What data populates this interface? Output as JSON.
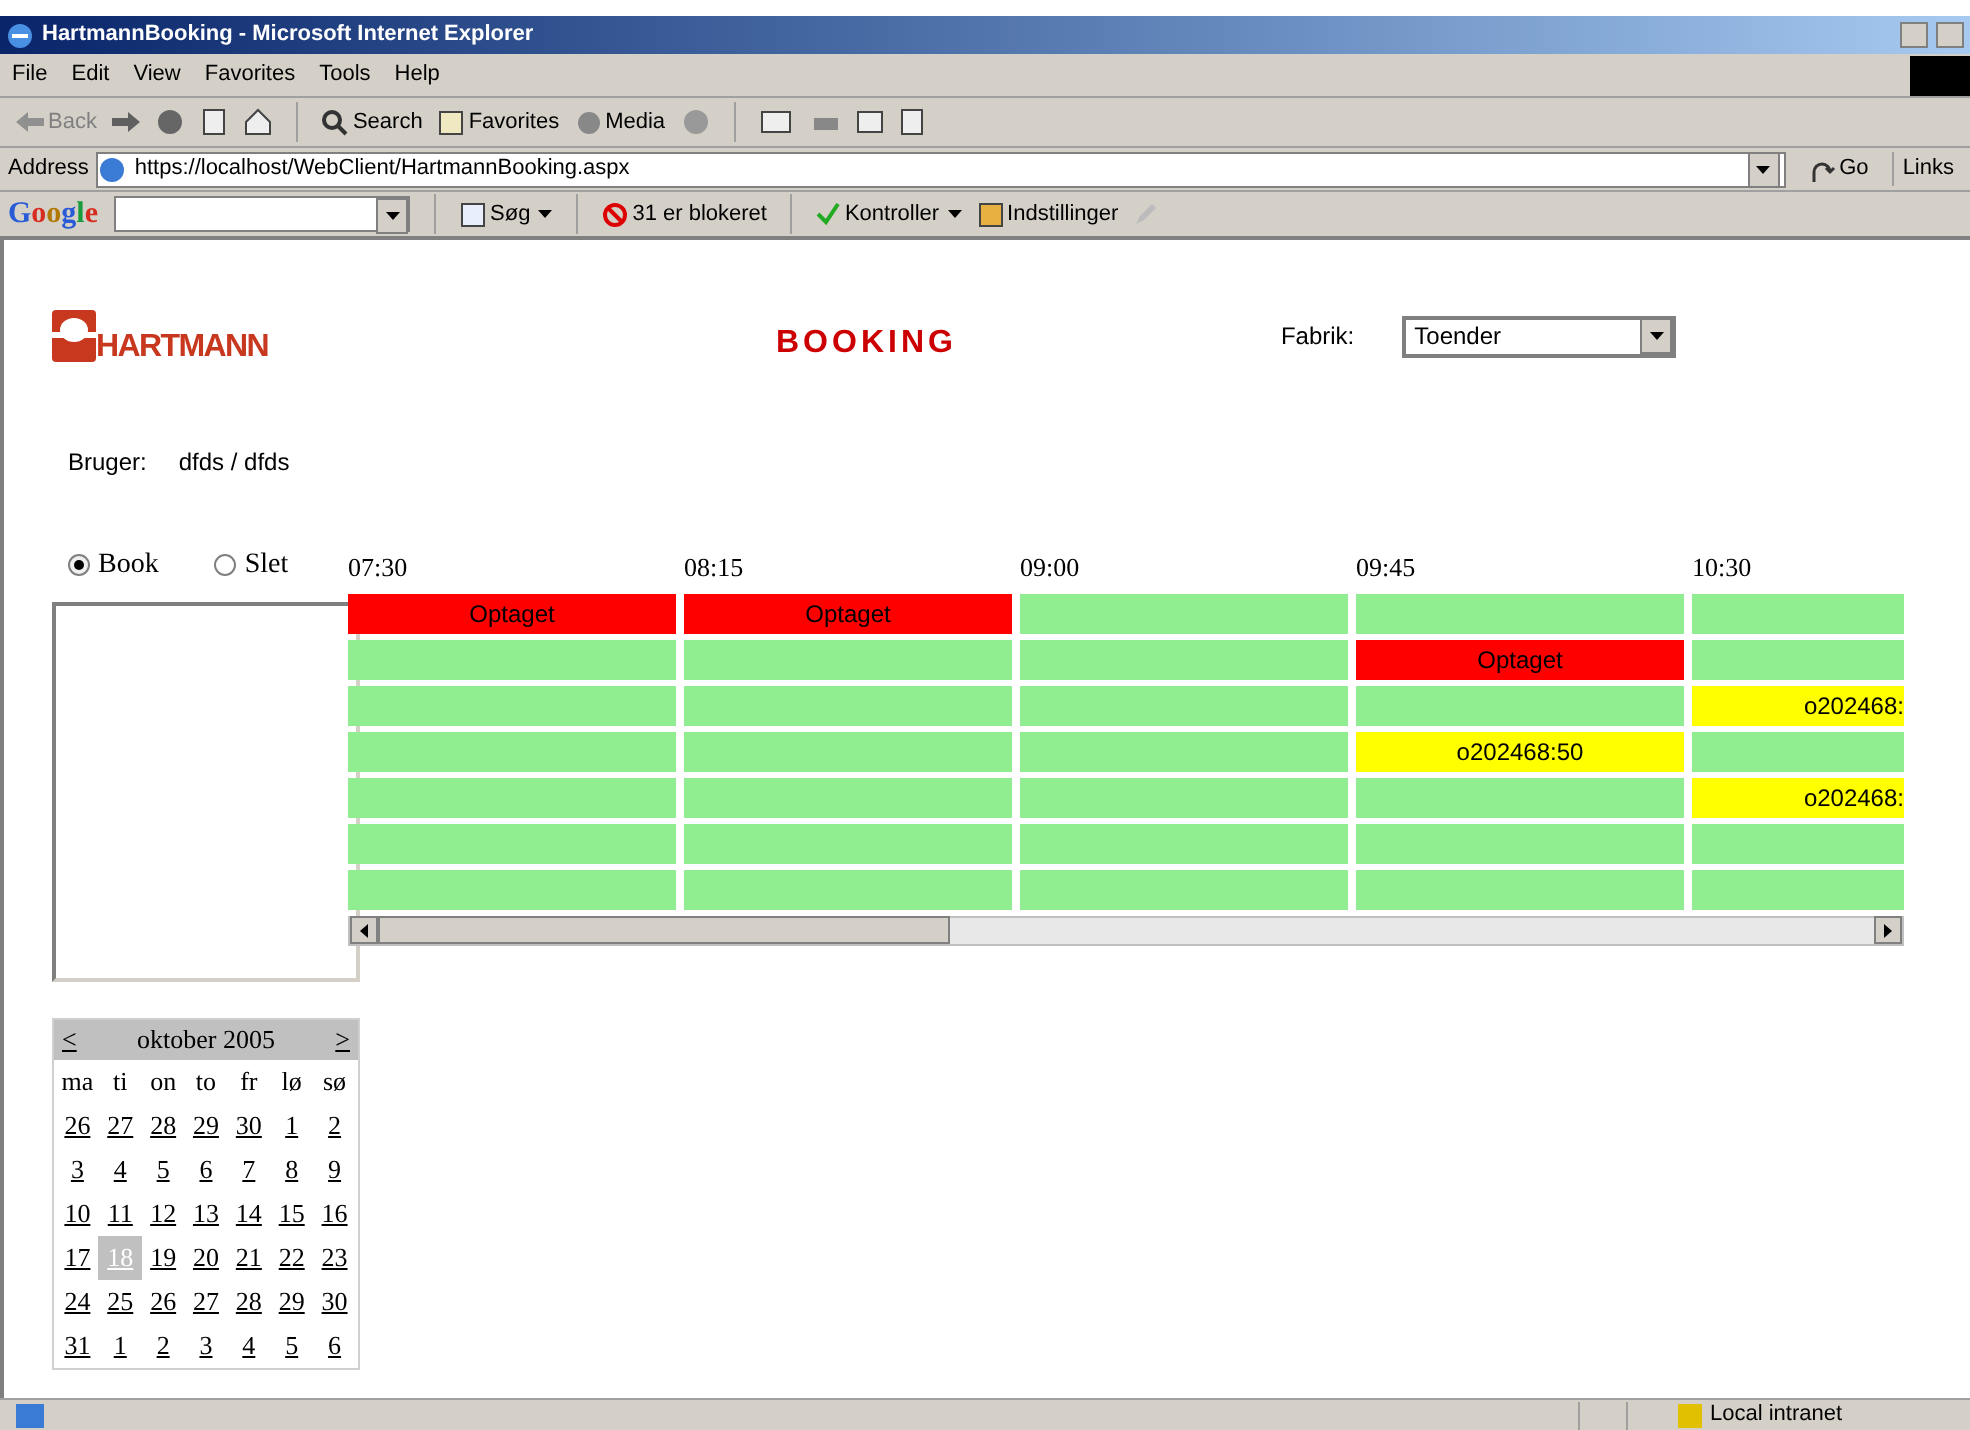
{
  "window": {
    "title": "HartmannBooking - Microsoft Internet Explorer"
  },
  "menu": [
    "File",
    "Edit",
    "View",
    "Favorites",
    "Tools",
    "Help"
  ],
  "toolbar": {
    "back": "Back",
    "search": "Search",
    "favorites": "Favorites",
    "media": "Media"
  },
  "address": {
    "label": "Address",
    "url": "https://localhost/WebClient/HartmannBooking.aspx",
    "go": "Go",
    "links": "Links"
  },
  "google_bar": {
    "logo": "Google",
    "search": "Søg",
    "blocked": "31 er blokeret",
    "check": "Kontroller",
    "settings": "Indstillinger"
  },
  "page": {
    "logo": "HARTMANN",
    "title": "BOOKING",
    "factory_label": "Fabrik:",
    "factory_value": "Toender",
    "user_label": "Bruger:",
    "user_value": "dfds / dfds",
    "modes": [
      {
        "label": "Book",
        "selected": true
      },
      {
        "label": "Slet",
        "selected": false
      }
    ],
    "times": [
      "07:30",
      "08:15",
      "09:00",
      "09:45",
      "10:30"
    ],
    "rows": [
      [
        {
          "kind": "busy",
          "text": "Optaget"
        },
        {
          "kind": "busy",
          "text": "Optaget"
        },
        {
          "kind": "free"
        },
        {
          "kind": "free"
        },
        {
          "kind": "free"
        }
      ],
      [
        {
          "kind": "free"
        },
        {
          "kind": "free"
        },
        {
          "kind": "free"
        },
        {
          "kind": "busy",
          "text": "Optaget"
        },
        {
          "kind": "free"
        }
      ],
      [
        {
          "kind": "free"
        },
        {
          "kind": "free"
        },
        {
          "kind": "free"
        },
        {
          "kind": "free"
        },
        {
          "kind": "order",
          "text": "o202468:"
        }
      ],
      [
        {
          "kind": "free"
        },
        {
          "kind": "free"
        },
        {
          "kind": "free"
        },
        {
          "kind": "order",
          "text": "o202468:50"
        },
        {
          "kind": "free"
        }
      ],
      [
        {
          "kind": "free"
        },
        {
          "kind": "free"
        },
        {
          "kind": "free"
        },
        {
          "kind": "free"
        },
        {
          "kind": "order",
          "text": "o202468:"
        }
      ],
      [
        {
          "kind": "free"
        },
        {
          "kind": "free"
        },
        {
          "kind": "free"
        },
        {
          "kind": "free"
        },
        {
          "kind": "free"
        }
      ],
      [
        {
          "kind": "free"
        },
        {
          "kind": "free"
        },
        {
          "kind": "free"
        },
        {
          "kind": "free"
        },
        {
          "kind": "free"
        }
      ]
    ],
    "calendar": {
      "prev": "<",
      "month": "oktober 2005",
      "next": ">",
      "weekdays": [
        "ma",
        "ti",
        "on",
        "to",
        "fr",
        "lø",
        "sø"
      ],
      "weeks": [
        [
          {
            "day": "26",
            "selected": false
          },
          {
            "day": "27",
            "selected": false
          },
          {
            "day": "28",
            "selected": false
          },
          {
            "day": "29",
            "selected": false
          },
          {
            "day": "30",
            "selected": false
          },
          {
            "day": "1",
            "selected": false
          },
          {
            "day": "2",
            "selected": false
          }
        ],
        [
          {
            "day": "3",
            "selected": false
          },
          {
            "day": "4",
            "selected": false
          },
          {
            "day": "5",
            "selected": false
          },
          {
            "day": "6",
            "selected": false
          },
          {
            "day": "7",
            "selected": false
          },
          {
            "day": "8",
            "selected": false
          },
          {
            "day": "9",
            "selected": false
          }
        ],
        [
          {
            "day": "10",
            "selected": false
          },
          {
            "day": "11",
            "selected": false
          },
          {
            "day": "12",
            "selected": false
          },
          {
            "day": "13",
            "selected": false
          },
          {
            "day": "14",
            "selected": false
          },
          {
            "day": "15",
            "selected": false
          },
          {
            "day": "16",
            "selected": false
          }
        ],
        [
          {
            "day": "17",
            "selected": false
          },
          {
            "day": "18",
            "selected": true
          },
          {
            "day": "19",
            "selected": false
          },
          {
            "day": "20",
            "selected": false
          },
          {
            "day": "21",
            "selected": false
          },
          {
            "day": "22",
            "selected": false
          },
          {
            "day": "23",
            "selected": false
          }
        ],
        [
          {
            "day": "24",
            "selected": false
          },
          {
            "day": "25",
            "selected": false
          },
          {
            "day": "26",
            "selected": false
          },
          {
            "day": "27",
            "selected": false
          },
          {
            "day": "28",
            "selected": false
          },
          {
            "day": "29",
            "selected": false
          },
          {
            "day": "30",
            "selected": false
          }
        ],
        [
          {
            "day": "31",
            "selected": false
          },
          {
            "day": "1",
            "selected": false
          },
          {
            "day": "2",
            "selected": false
          },
          {
            "day": "3",
            "selected": false
          },
          {
            "day": "4",
            "selected": false
          },
          {
            "day": "5",
            "selected": false
          },
          {
            "day": "6",
            "selected": false
          }
        ]
      ]
    }
  },
  "status_bar": {
    "zone": "Local intranet"
  }
}
